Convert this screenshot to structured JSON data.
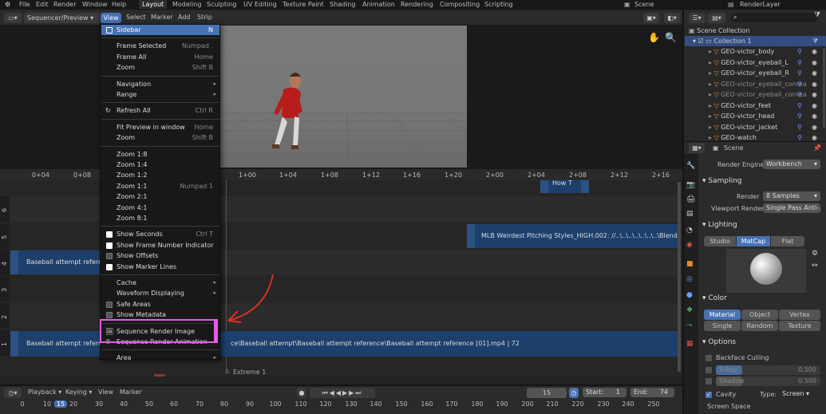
{
  "topbar": {
    "menus": [
      "File",
      "Edit",
      "Render",
      "Window",
      "Help"
    ],
    "workspaces": [
      "Layout",
      "Modeling",
      "Sculpting",
      "UV Editing",
      "Texture Paint",
      "Shading",
      "Animation",
      "Rendering",
      "Compositing",
      "Scripting"
    ],
    "active_workspace": "Layout",
    "scene": "Scene",
    "view_layer": "RenderLayer"
  },
  "seq_header": {
    "mode": "Sequencer/Preview",
    "menus": [
      "View",
      "Select",
      "Marker",
      "Add",
      "Strip"
    ]
  },
  "view_menu": {
    "items": [
      {
        "label": "Sidebar",
        "shortcut": "N",
        "check": "off",
        "highlighted": true
      },
      {
        "sep": true
      },
      {
        "label": "Frame Selected",
        "shortcut": "Numpad ."
      },
      {
        "label": "Frame All",
        "shortcut": "Home"
      },
      {
        "label": "Zoom",
        "shortcut": "Shift B"
      },
      {
        "sep": true
      },
      {
        "label": "Navigation",
        "submenu": true
      },
      {
        "label": "Range",
        "submenu": true
      },
      {
        "sep": true
      },
      {
        "label": "Refresh All",
        "shortcut": "Ctrl R",
        "icon": "refresh"
      },
      {
        "sep": true
      },
      {
        "label": "Fit Preview in window",
        "shortcut": "Home"
      },
      {
        "label": "Zoom",
        "shortcut": "Shift B"
      },
      {
        "sep": true
      },
      {
        "label": "Zoom 1:8"
      },
      {
        "label": "Zoom 1:4"
      },
      {
        "label": "Zoom 1:2"
      },
      {
        "label": "Zoom 1:1",
        "shortcut": "Numpad 1"
      },
      {
        "label": "Zoom 2:1"
      },
      {
        "label": "Zoom 4:1"
      },
      {
        "label": "Zoom 8:1"
      },
      {
        "sep": true
      },
      {
        "label": "Show Seconds",
        "shortcut": "Ctrl T",
        "check": "on"
      },
      {
        "label": "Show Frame Number Indicator",
        "check": "on"
      },
      {
        "label": "Show Offsets",
        "check": "off"
      },
      {
        "label": "Show Marker Lines",
        "check": "on"
      },
      {
        "sep": true
      },
      {
        "label": "Cache",
        "submenu": true
      },
      {
        "label": "Waveform Displaying",
        "submenu": true
      },
      {
        "label": "Safe Areas",
        "check": "off"
      },
      {
        "label": "Show Metadata",
        "check": "off"
      },
      {
        "sep": true
      },
      {
        "label": "Sequence Render Image",
        "icon": "render-image",
        "boxed": true
      },
      {
        "label": "Sequence Render Animation",
        "icon": "render-anim",
        "boxed": true
      },
      {
        "sep": true
      },
      {
        "label": "Area",
        "submenu": true
      }
    ]
  },
  "timeline_ruler": [
    "0+04",
    "0+08",
    "1+00",
    "1+04",
    "1+08",
    "1+12",
    "1+16",
    "1+20",
    "2+00",
    "2+04",
    "2+08",
    "2+12",
    "2+16"
  ],
  "channels": [
    "6",
    "5",
    "4",
    "3",
    "2",
    "1"
  ],
  "strips": {
    "how_to": "How T",
    "mlb": "MLB Weirdest Pitching Styles_HIGH.002: //..\\..\\..\\..\\..\\..\\..\\Blender\\Reference",
    "baseball4": "Baseball attempt reference",
    "baseball1_left": "Baseball attempt reference",
    "baseball1_right": "ce\\Baseball attempt\\Baseball attempt reference\\Baseball attempt reference [01].mp4 | 72"
  },
  "marker_label": "Extreme 1",
  "playback": {
    "menus": [
      "Playback",
      "Keying",
      "View",
      "Marker"
    ],
    "current_frame": "15",
    "start_label": "Start:",
    "start": "1",
    "end_label": "End:",
    "end": "74"
  },
  "frame_ruler": [
    "0",
    "10",
    "15",
    "20",
    "30",
    "40",
    "50",
    "60",
    "70",
    "80",
    "90",
    "100",
    "110",
    "120",
    "130",
    "140",
    "150",
    "160",
    "170",
    "180",
    "190",
    "200",
    "210",
    "220",
    "230",
    "240",
    "250"
  ],
  "outliner": {
    "search_placeholder": "",
    "scene_collection": "Scene Collection",
    "collection": "Collection 1",
    "items": [
      "GEO-victor_body",
      "GEO-victor_eyeball_L",
      "GEO-victor_eyeball_R",
      "GEO-victor_eyeball_cornea",
      "GEO-victor_eyeball_cornea",
      "GEO-victor_feet",
      "GEO-victor_head",
      "GEO-victor_jacket",
      "GEO-watch"
    ]
  },
  "properties": {
    "scene_label": "Scene",
    "render_engine_label": "Render Engine",
    "render_engine": "Workbench",
    "sampling": "Sampling",
    "render_label": "Render",
    "render_value": "8 Samples",
    "viewport_render_label": "Viewport Render",
    "viewport_render_value": "Single Pass Anti-...",
    "lighting": "Lighting",
    "lighting_tabs": [
      "Studio",
      "MatCap",
      "Flat"
    ],
    "color": "Color",
    "color_opts": [
      "Material",
      "Object",
      "Vertex",
      "Single",
      "Random",
      "Texture"
    ],
    "options": "Options",
    "backface": "Backface Culling",
    "xray_label": "X-Ray",
    "xray": "0.500",
    "shadow_label": "Shadow",
    "shadow": "0.500",
    "cavity": "Cavity",
    "type_label": "Type:",
    "type_value": "Screen",
    "screen_space": "Screen Space"
  },
  "colors": {
    "accent": "#4772b3",
    "strip_blue": "#1d3f6b",
    "highlight_box": "#e35ce3",
    "arrow": "#d93025"
  }
}
